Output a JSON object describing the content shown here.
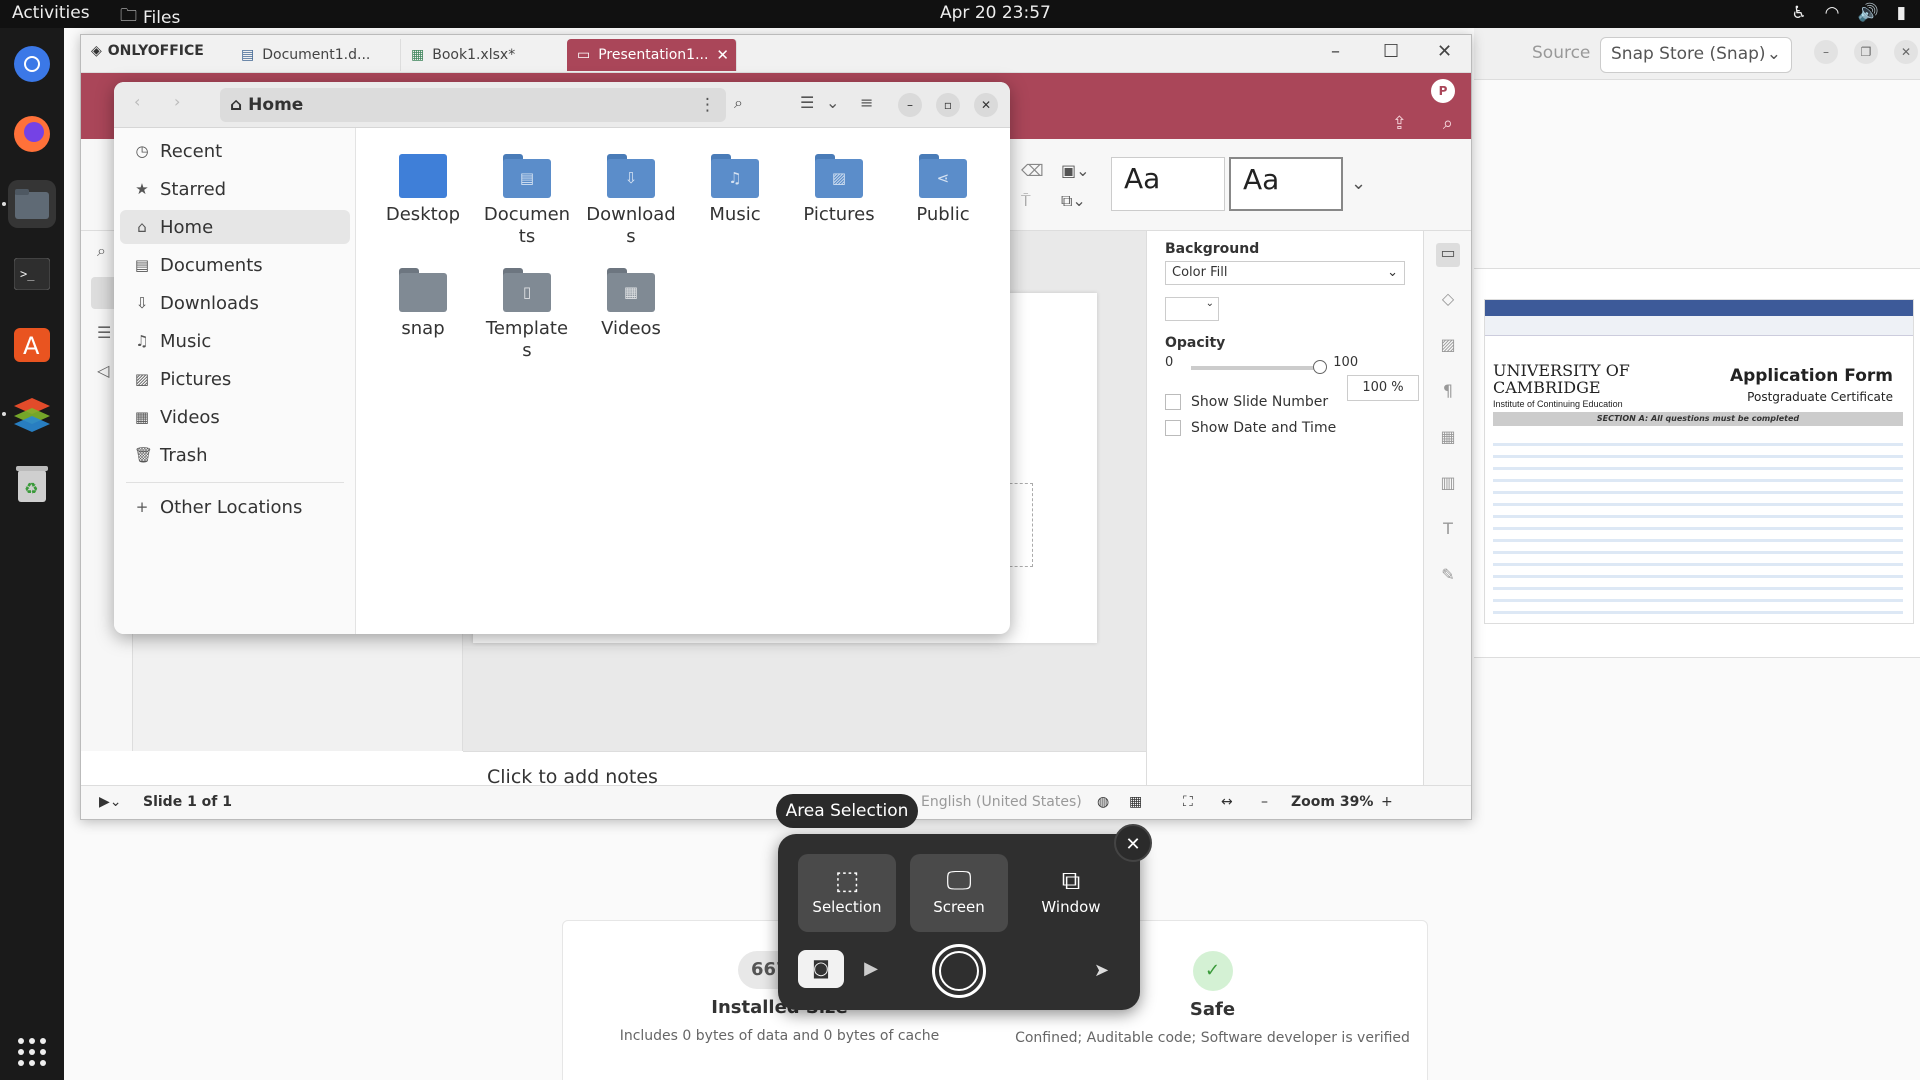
{
  "topbar": {
    "activities": "Activities",
    "app": "Files",
    "clock": "Apr 20  23:57"
  },
  "store": {
    "source_label": "Source",
    "source_value": "Snap Store (Snap)",
    "preview": {
      "uni_line1": "UNIVERSITY OF",
      "uni_line2": "CAMBRIDGE",
      "uni_sub": "Institute of Continuing Education",
      "form_title": "Application Form",
      "form_sub": "Postgraduate Certificate",
      "section": "SECTION A: All questions must be completed"
    },
    "installed_badge": "667.5",
    "installed_label": "Installed Size",
    "installed_desc": "Includes 0 bytes of data and 0 bytes of cache",
    "safe_label": "Safe",
    "safe_desc": "Confined; Auditable code; Software developer is verified"
  },
  "onlyoffice": {
    "brand": "ONLYOFFICE",
    "tabs": [
      {
        "label": "Document1.d..."
      },
      {
        "label": "Book1.xlsx*"
      },
      {
        "label": "Presentation1..."
      }
    ],
    "avatar": "P",
    "theme_label": "Aa",
    "notes_placeholder": "Click to add notes",
    "props": {
      "background": "Background",
      "fill": "Color Fill",
      "opacity": "Opacity",
      "opacity_min": "0",
      "opacity_max": "100",
      "opacity_value": "100 %",
      "show_slide_number": "Show Slide Number",
      "show_date_time": "Show Date and Time"
    },
    "status": {
      "slide": "Slide 1 of 1",
      "language": "English (United States)",
      "zoom": "Zoom 39%"
    }
  },
  "files": {
    "path": "Home",
    "sidebar": [
      {
        "label": "Recent",
        "icon": "clock-icon"
      },
      {
        "label": "Starred",
        "icon": "star-icon"
      },
      {
        "label": "Home",
        "icon": "home-icon"
      },
      {
        "label": "Documents",
        "icon": "document-icon"
      },
      {
        "label": "Downloads",
        "icon": "download-icon"
      },
      {
        "label": "Music",
        "icon": "music-icon"
      },
      {
        "label": "Pictures",
        "icon": "picture-icon"
      },
      {
        "label": "Videos",
        "icon": "video-icon"
      },
      {
        "label": "Trash",
        "icon": "trash-icon"
      }
    ],
    "other_locations": "Other Locations",
    "folders": [
      {
        "line1": "Desktop",
        "line2": ""
      },
      {
        "line1": "Documen",
        "line2": "ts"
      },
      {
        "line1": "Download",
        "line2": "s"
      },
      {
        "line1": "Music",
        "line2": ""
      },
      {
        "line1": "Pictures",
        "line2": ""
      },
      {
        "line1": "Public",
        "line2": ""
      },
      {
        "line1": "snap",
        "line2": ""
      },
      {
        "line1": "Template",
        "line2": "s"
      },
      {
        "line1": "Videos",
        "line2": ""
      }
    ]
  },
  "screenshot": {
    "tooltip": "Area Selection",
    "modes": [
      "Selection",
      "Screen",
      "Window"
    ]
  }
}
